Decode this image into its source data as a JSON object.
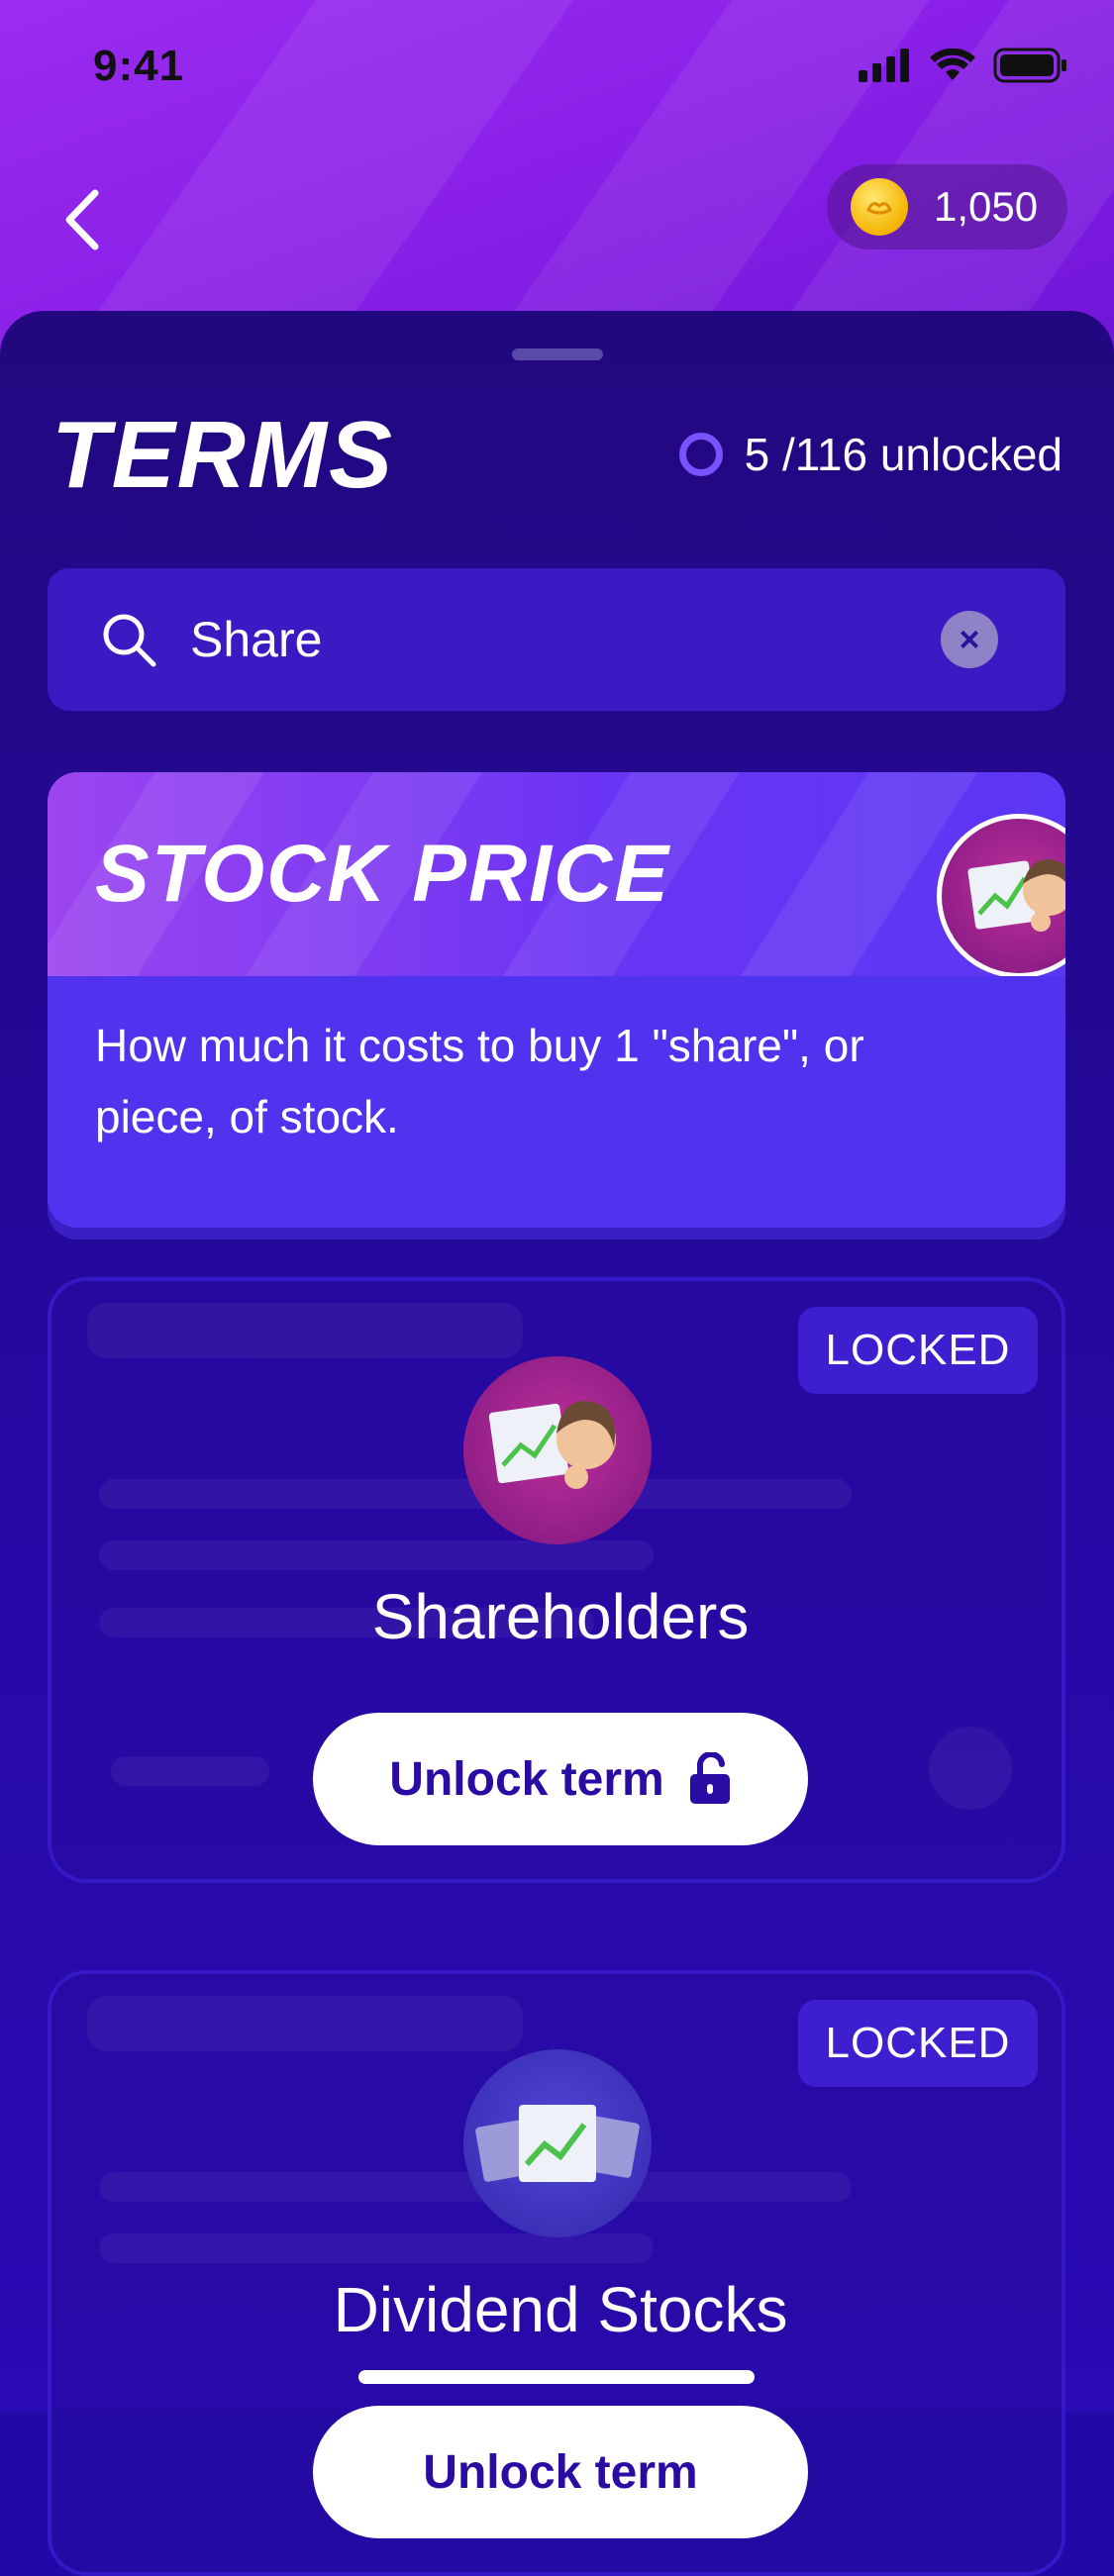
{
  "status_bar": {
    "time": "9:41"
  },
  "header": {
    "coins": "1,050"
  },
  "sheet": {
    "title": "TERMS",
    "progress": "5 /116 unlocked"
  },
  "search": {
    "value": "Share",
    "placeholder": ""
  },
  "featured_term": {
    "title": "STOCK PRICE",
    "description": "How much it costs to buy 1 \"share\", or piece, of stock."
  },
  "locked_terms": [
    {
      "name": "Shareholders",
      "badge": "LOCKED",
      "button_label": "Unlock term"
    },
    {
      "name": "Dividend Stocks",
      "badge": "LOCKED",
      "button_label": "Unlock term"
    }
  ],
  "colors": {
    "accent": "#4f33ee",
    "background": "#2208a8",
    "header": "#9b2cf0"
  }
}
